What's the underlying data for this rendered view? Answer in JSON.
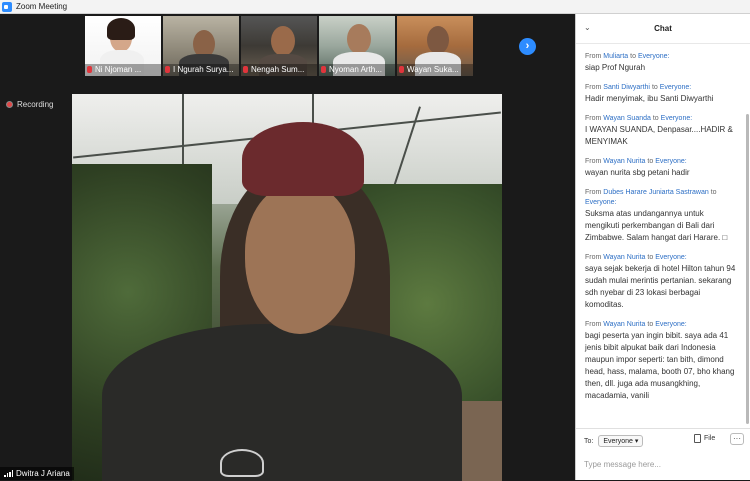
{
  "window": {
    "title": "Zoom Meeting",
    "accent": "#2d8cff"
  },
  "thumbnails": [
    {
      "name": "Ni Njoman ..."
    },
    {
      "name": "I Ngurah Surya..."
    },
    {
      "name": "Nengah Sum..."
    },
    {
      "name": "Nyoman Arth..."
    },
    {
      "name": "Wayan Suka..."
    }
  ],
  "recording": {
    "label": "Recording"
  },
  "self_view": {
    "name": "Dwitra J Ariana"
  },
  "chat": {
    "title": "Chat",
    "messages": [
      {
        "from_prefix": "From",
        "sender": "Muliarta",
        "to_label": "to",
        "recipient": "Everyone:",
        "text": "siap Prof Ngurah"
      },
      {
        "from_prefix": "From",
        "sender": "Santi Diwyarthi",
        "to_label": "to",
        "recipient": "Everyone:",
        "text": "Hadir menyimak, ibu Santi Diwyarthi"
      },
      {
        "from_prefix": "From",
        "sender": "Wayan Suanda",
        "to_label": "to",
        "recipient": "Everyone:",
        "text": "I WAYAN SUANDA, Denpasar....HADIR & MENYIMAK"
      },
      {
        "from_prefix": "From",
        "sender": "Wayan Nurita",
        "to_label": "to",
        "recipient": "Everyone:",
        "text": "wayan nurita sbg petani hadir"
      },
      {
        "from_prefix": "From",
        "sender": "Dubes Harare Juniarta Sastrawan",
        "to_label": "to",
        "recipient": "Everyone:",
        "text": "Suksma atas undangannya untuk mengikuti perkembangan di Bali dari Zimbabwe. Salam hangat dari Harare. □"
      },
      {
        "from_prefix": "From",
        "sender": "Wayan Nurita",
        "to_label": "to",
        "recipient": "Everyone:",
        "text": "saya sejak bekerja di hotel Hilton tahun 94 sudah mulai merintis pertanian. sekarang sdh nyebar di 23 lokasi berbagai komoditas."
      },
      {
        "from_prefix": "From",
        "sender": "Wayan Nurita",
        "to_label": "to",
        "recipient": "Everyone:",
        "text": "bagi peserta yan ingin bibit. saya ada 41 jenis bibit alpukat baik dari Indonesia maupun impor seperti: tan bith, dimond head, hass, malama, booth 07, bho khang then, dll. juga ada musangkhing, macadamia, vanili"
      }
    ],
    "to_label": "To:",
    "to_value": "Everyone",
    "file_label": "File",
    "more_label": "···",
    "input_placeholder": "Type message here..."
  }
}
